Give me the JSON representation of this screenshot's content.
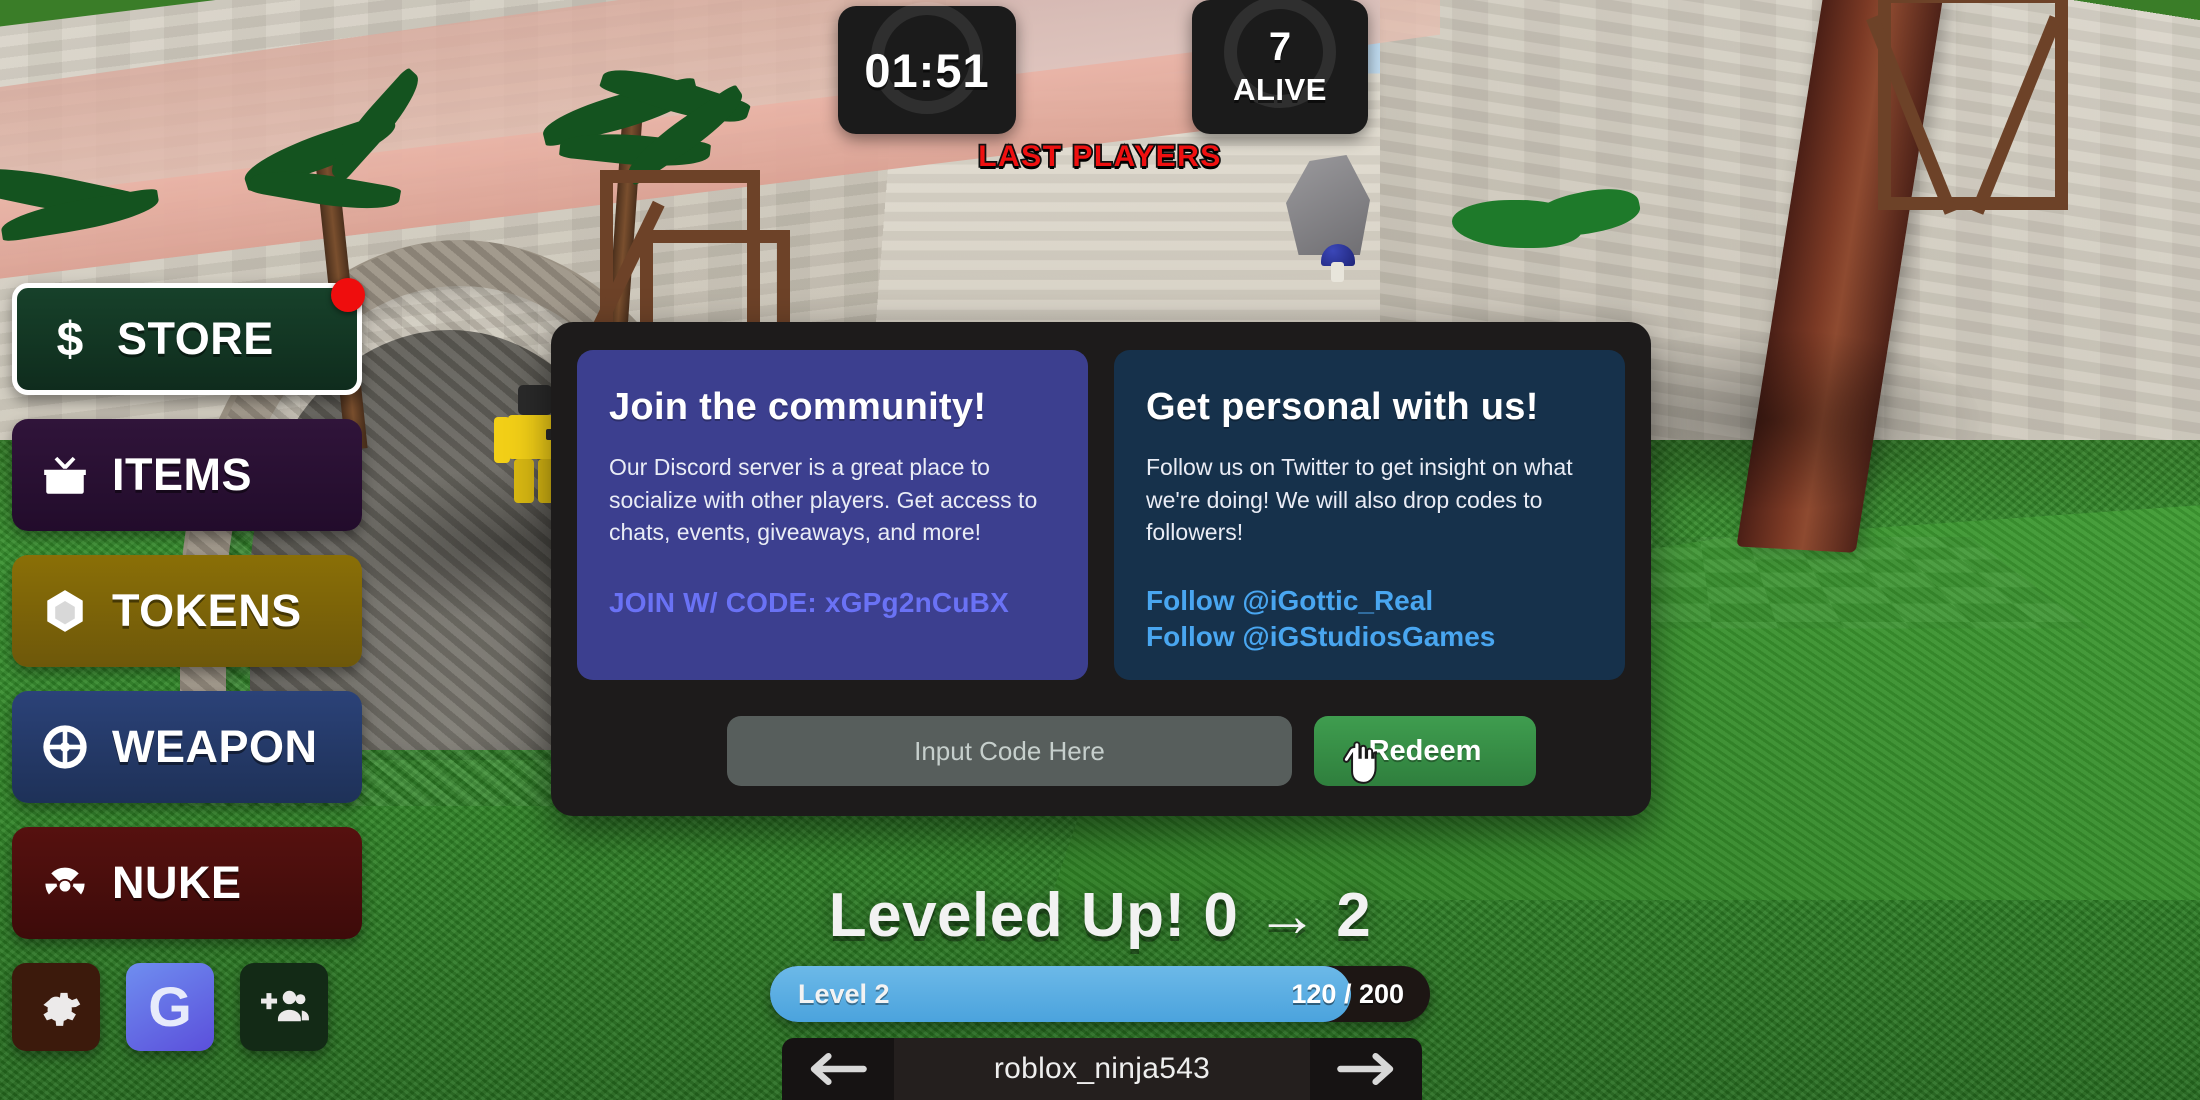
{
  "hud": {
    "timer": "01:51",
    "alive_count": "7",
    "alive_label": "ALIVE",
    "last_players": "LAST PLAYERS",
    "last_players_color": "#ef1010"
  },
  "sidebar": {
    "items": [
      {
        "id": "store",
        "label": "STORE",
        "icon": "dollar-icon",
        "color": "#17412a",
        "badge": true
      },
      {
        "id": "items",
        "label": "ITEMS",
        "icon": "gift-box-icon",
        "color": "#30143a",
        "badge": false
      },
      {
        "id": "tokens",
        "label": "TOKENS",
        "icon": "hexagon-icon",
        "color": "#8a6f07",
        "badge": false
      },
      {
        "id": "weapon",
        "label": "WEAPON",
        "icon": "crosshair-icon",
        "color": "#2b4278",
        "badge": false
      },
      {
        "id": "nuke",
        "label": "NUKE",
        "icon": "radiation-icon",
        "color": "#56110f",
        "badge": false
      }
    ],
    "mini_buttons": [
      {
        "id": "settings",
        "icon": "gear-icon",
        "color": "#3c1a0c"
      },
      {
        "id": "group",
        "icon": "letter-g-icon",
        "color": "#5b4fdb",
        "label": "G"
      },
      {
        "id": "invite",
        "icon": "add-friend-icon",
        "color": "#132a16"
      }
    ]
  },
  "codes_dialog": {
    "discord": {
      "title": "Join the community!",
      "body": "Our Discord server is a great place to socialize with other players. Get access to chats, events, giveaways, and more!",
      "code_link": "JOIN W/ CODE: xGPg2nCuBX",
      "code": "xGPg2nCuBX",
      "panel_color": "#3c3f8f",
      "link_color": "#6a72f5"
    },
    "twitter": {
      "title": "Get personal with us!",
      "body": "Follow us on Twitter to get insight on what we're doing! We will also drop codes to followers!",
      "links": [
        "Follow @iGottic_Real",
        "Follow @iGStudiosGames"
      ],
      "panel_color": "#16314b",
      "link_color": "#49a6f0"
    },
    "input_placeholder": "Input Code Here",
    "input_value": "",
    "redeem_label": "Redeem",
    "redeem_color": "#3f9d4f"
  },
  "levelup": {
    "message": "Leveled Up! 0 → 2",
    "from_level": "0",
    "to_level": "2",
    "bar_level_label": "Level 2",
    "xp_current": "120",
    "xp_max": "200",
    "xp_text": "120 / 200",
    "fill_color": "#4ba3dd"
  },
  "player_selector": {
    "username": "roblox_ninja543",
    "prev_icon": "arrow-left-icon",
    "next_icon": "arrow-right-icon"
  }
}
